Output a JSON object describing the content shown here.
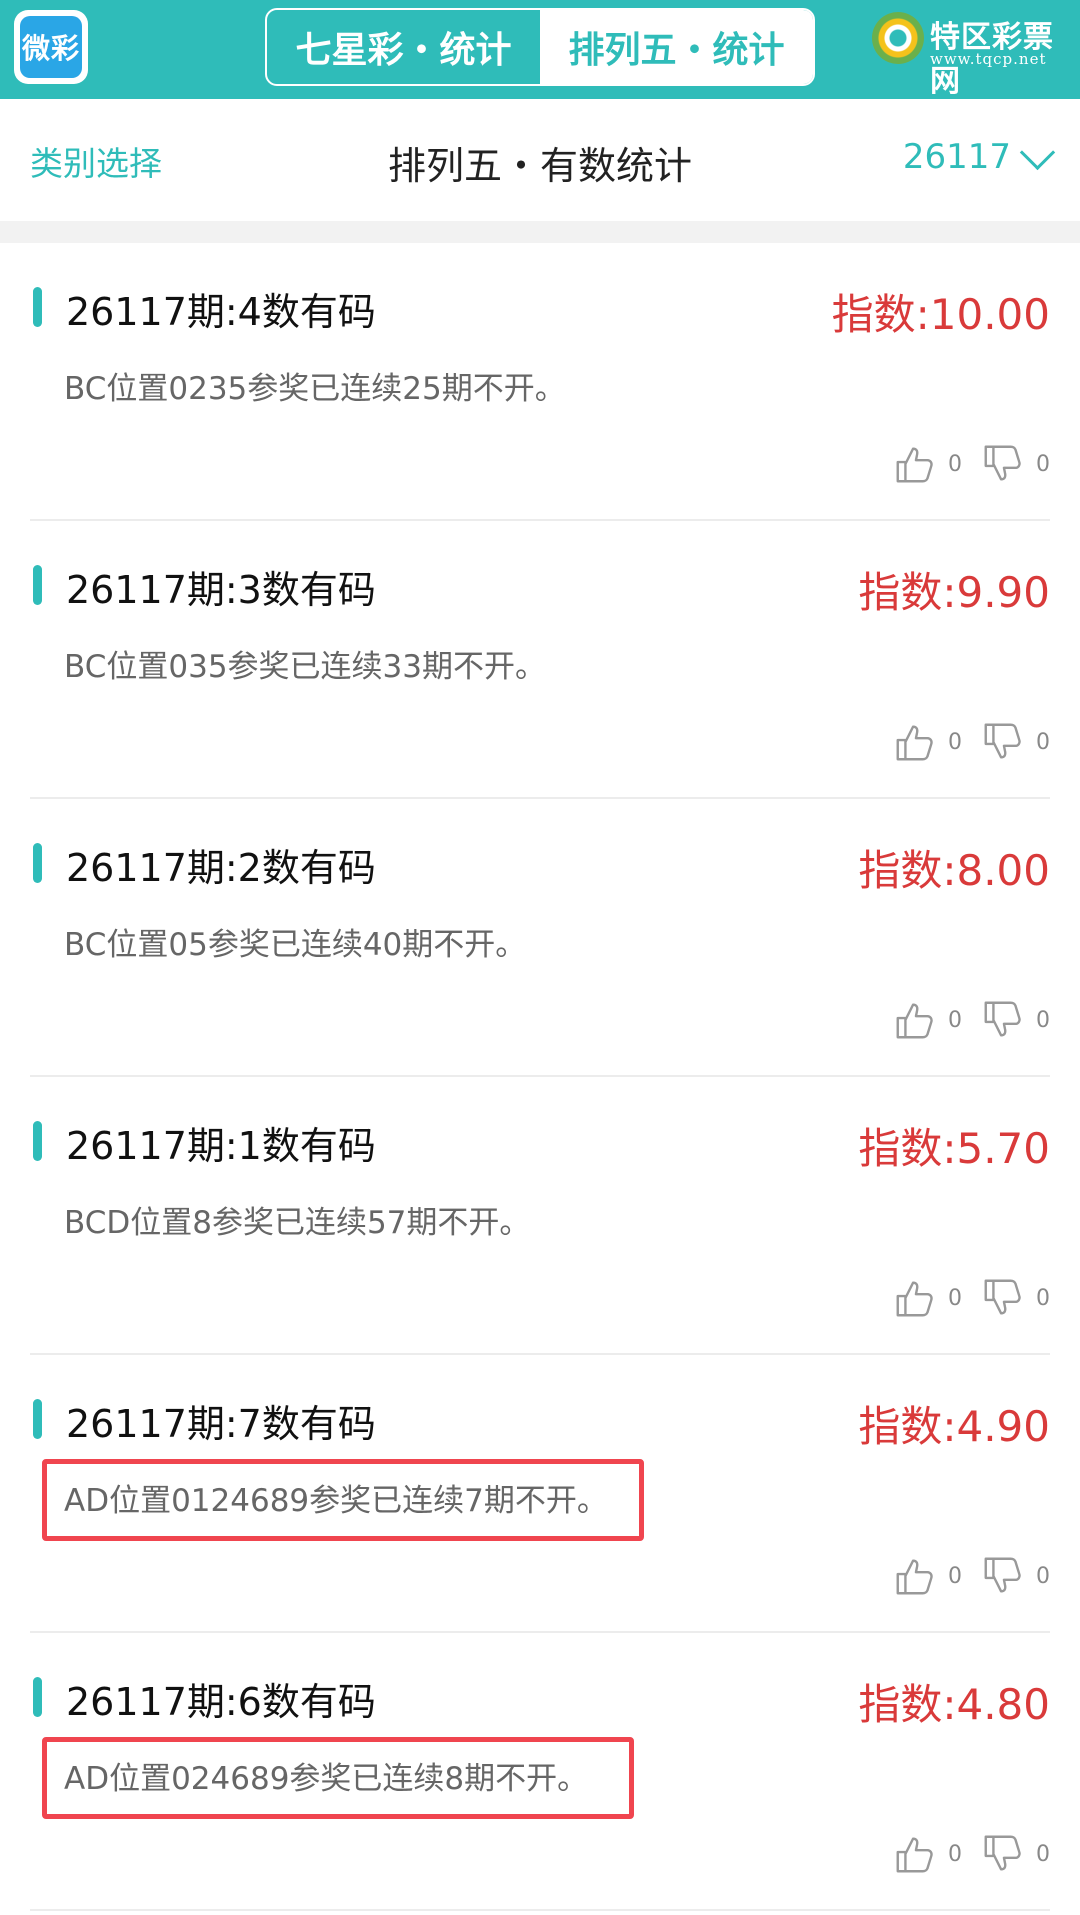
{
  "topbar": {
    "app_logo_text": "微彩",
    "tabs": [
      {
        "label": "七星彩・统计",
        "active": false
      },
      {
        "label": "排列五・统计",
        "active": true
      }
    ],
    "brand_name": "特区彩票网",
    "brand_url": "www.tqcp.net"
  },
  "subheader": {
    "category_label": "类别选择",
    "title": "排列五・有数统计",
    "issue": "26117"
  },
  "items": [
    {
      "title": "26117期:4数有码",
      "index": "指数:10.00",
      "desc": "BC位置0235参奖已连续25期不开。",
      "likes": "0",
      "dislikes": "0",
      "highlighted": false
    },
    {
      "title": "26117期:3数有码",
      "index": "指数:9.90",
      "desc": "BC位置035参奖已连续33期不开。",
      "likes": "0",
      "dislikes": "0",
      "highlighted": false
    },
    {
      "title": "26117期:2数有码",
      "index": "指数:8.00",
      "desc": "BC位置05参奖已连续40期不开。",
      "likes": "0",
      "dislikes": "0",
      "highlighted": false
    },
    {
      "title": "26117期:1数有码",
      "index": "指数:5.70",
      "desc": "BCD位置8参奖已连续57期不开。",
      "likes": "0",
      "dislikes": "0",
      "highlighted": false
    },
    {
      "title": "26117期:7数有码",
      "index": "指数:4.90",
      "desc": "AD位置0124689参奖已连续7期不开。",
      "likes": "0",
      "dislikes": "0",
      "highlighted": true
    },
    {
      "title": "26117期:6数有码",
      "index": "指数:4.80",
      "desc": "AD位置024689参奖已连续8期不开。",
      "likes": "0",
      "dislikes": "0",
      "highlighted": true
    }
  ],
  "colors": {
    "accent": "#2fbcb9",
    "index_red": "#d93a3a",
    "highlight_red": "#f0454f"
  },
  "icons": [
    "thumbs-up-icon",
    "thumbs-down-icon",
    "chevron-down-icon"
  ]
}
